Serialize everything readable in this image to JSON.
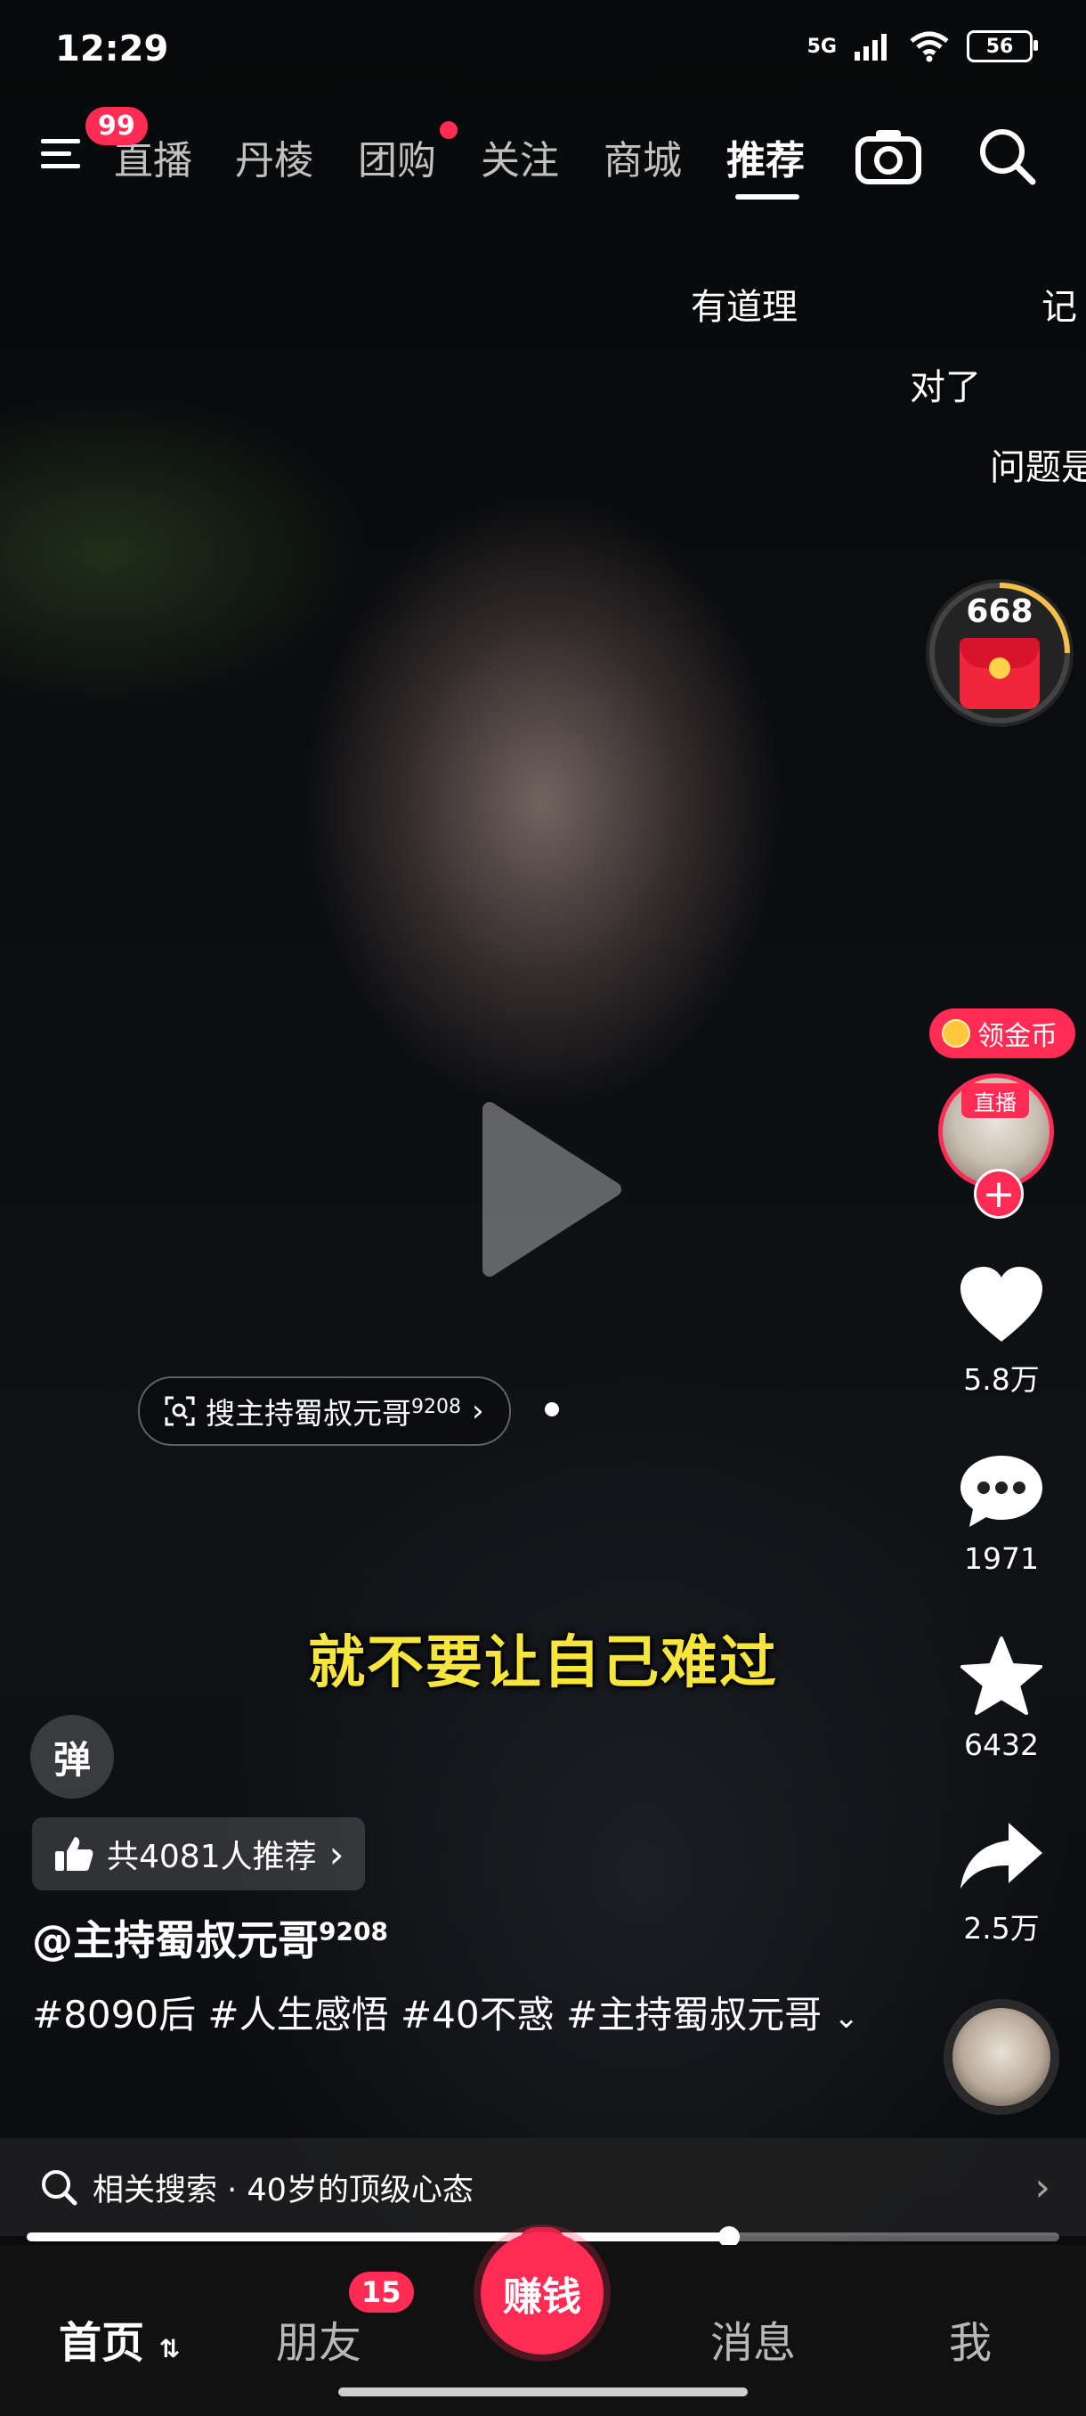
{
  "status_bar": {
    "time": "12:29",
    "network": "5G",
    "battery": "56"
  },
  "top_nav": {
    "menu_badge": "99",
    "tabs": [
      "直播",
      "丹棱",
      "团购",
      "关注",
      "商城",
      "推荐"
    ],
    "active_tab": "推荐"
  },
  "danmaku": [
    "有道理",
    "记",
    "对了",
    "问题是"
  ],
  "coin_widget": {
    "count": "668"
  },
  "side_actions": {
    "gold_label": "领金币",
    "live_tag": "直播",
    "like_count": "5.8万",
    "comment_count": "1971",
    "favorite_count": "6432",
    "share_count": "2.5万"
  },
  "video": {
    "search_chip": "搜主持蜀叔元哥",
    "search_chip_sup": "9208",
    "subtitle": "就不要让自己难过",
    "danmu_button": "弹",
    "recommend_chip": "共4081人推荐",
    "author": "@主持蜀叔元哥",
    "author_sup": "9208",
    "description": "#8090后 #人生感悟 #40不惑 #主持蜀叔元哥",
    "progress": 0.68
  },
  "related_search": {
    "label": "相关搜索 · 40岁的顶级心态"
  },
  "bottom_nav": {
    "home": "首页",
    "friends": "朋友",
    "friends_badge": "15",
    "earn": "赚钱",
    "messages": "消息",
    "me": "我"
  },
  "colors": {
    "accent": "#fe2c55",
    "subtitle": "#f6e53a"
  }
}
